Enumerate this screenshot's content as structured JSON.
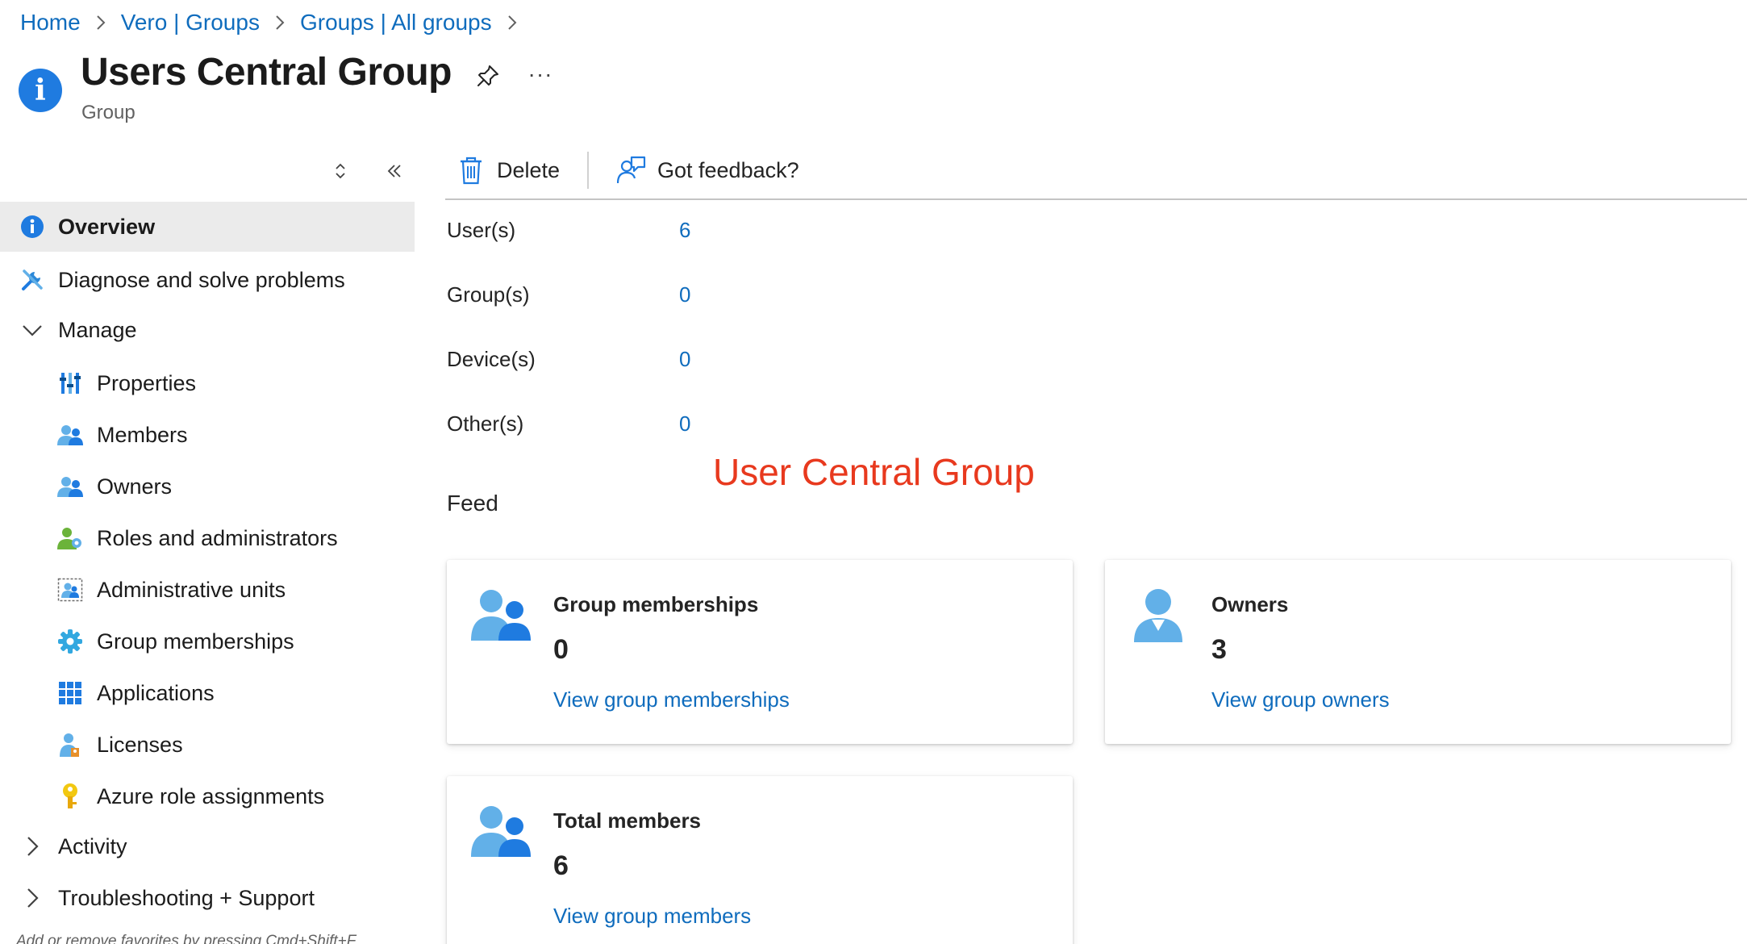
{
  "breadcrumb": {
    "items": [
      "Home",
      "Vero | Groups",
      "Groups | All groups"
    ]
  },
  "header": {
    "title": "Users Central Group",
    "subtitle": "Group",
    "more_label": "···"
  },
  "toolbar": {
    "delete_label": "Delete",
    "feedback_label": "Got feedback?"
  },
  "sidebar": {
    "items": [
      {
        "label": "Overview",
        "icon": "info-icon",
        "active": true
      },
      {
        "label": "Diagnose and solve problems",
        "icon": "wrench-icon"
      },
      {
        "label": "Manage",
        "icon": "chevron-down-icon"
      },
      {
        "label": "Properties",
        "icon": "properties-icon"
      },
      {
        "label": "Members",
        "icon": "members-icon"
      },
      {
        "label": "Owners",
        "icon": "owners-icon"
      },
      {
        "label": "Roles and administrators",
        "icon": "roles-icon"
      },
      {
        "label": "Administrative units",
        "icon": "admin-units-icon"
      },
      {
        "label": "Group memberships",
        "icon": "gear-icon"
      },
      {
        "label": "Applications",
        "icon": "apps-grid-icon"
      },
      {
        "label": "Licenses",
        "icon": "licenses-icon"
      },
      {
        "label": "Azure role assignments",
        "icon": "key-icon"
      },
      {
        "label": "Activity",
        "icon": "chevron-right-icon"
      },
      {
        "label": "Troubleshooting + Support",
        "icon": "chevron-right-icon"
      }
    ],
    "favorites_hint": "Add or remove favorites by pressing Cmd+Shift+F"
  },
  "stats": [
    {
      "label": "User(s)",
      "value": "6"
    },
    {
      "label": "Group(s)",
      "value": "0"
    },
    {
      "label": "Device(s)",
      "value": "0"
    },
    {
      "label": "Other(s)",
      "value": "0"
    }
  ],
  "annotation": "User Central Group",
  "feed": {
    "title": "Feed",
    "cards": [
      {
        "title": "Group memberships",
        "value": "0",
        "link": "View group memberships",
        "icon": "group-users-icon"
      },
      {
        "title": "Owners",
        "value": "3",
        "link": "View group owners",
        "icon": "user-icon"
      },
      {
        "title": "Total members",
        "value": "6",
        "link": "View group members",
        "icon": "group-users-icon"
      }
    ]
  },
  "colors": {
    "link": "#0f6cbd",
    "annotation": "#e8391e",
    "active_nav_bg": "#ebebeb",
    "info_icon": "#1f7be0"
  }
}
